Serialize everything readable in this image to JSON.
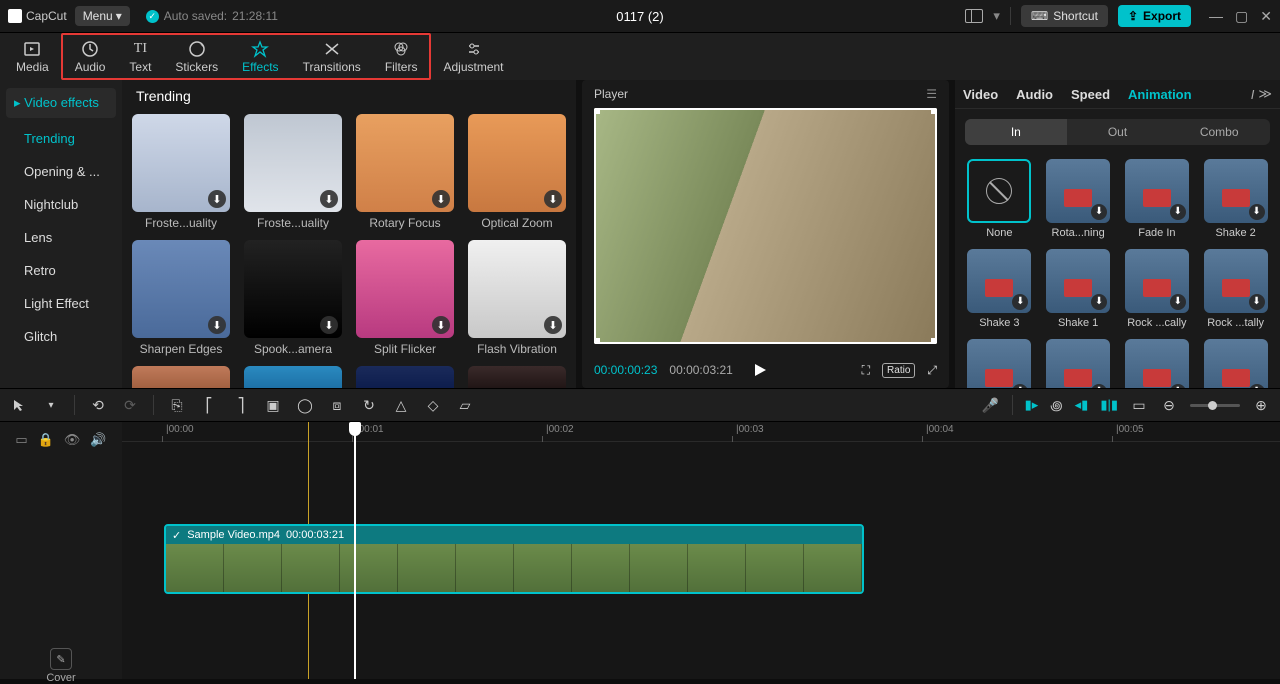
{
  "topbar": {
    "app_name": "CapCut",
    "menu_label": "Menu",
    "autosave_label": "Auto saved:",
    "autosave_time": "21:28:11",
    "doc_title": "0117 (2)",
    "shortcut_label": "Shortcut",
    "export_label": "Export"
  },
  "tooltabs": {
    "media": "Media",
    "audio": "Audio",
    "text": "Text",
    "stickers": "Stickers",
    "effects": "Effects",
    "transitions": "Transitions",
    "filters": "Filters",
    "adjustment": "Adjustment"
  },
  "effects_panel": {
    "header": "Video effects",
    "categories": [
      "Trending",
      "Opening & ...",
      "Nightclub",
      "Lens",
      "Retro",
      "Light Effect",
      "Glitch"
    ],
    "grid_title": "Trending",
    "items": [
      {
        "label": "Froste...uality",
        "bg": "linear-gradient(#cfd8e8,#a7b5cc)"
      },
      {
        "label": "Froste...uality",
        "bg": "linear-gradient(#bfc7d2,#e0e4ea)"
      },
      {
        "label": "Rotary Focus",
        "bg": "linear-gradient(#e8a060,#d08048)"
      },
      {
        "label": "Optical Zoom",
        "bg": "linear-gradient(#e89a58,#c87840)"
      },
      {
        "label": "Sharpen Edges",
        "bg": "linear-gradient(#6a89b8,#4a6a9a)"
      },
      {
        "label": "Spook...amera",
        "bg": "linear-gradient(#222,#000)"
      },
      {
        "label": "Split Flicker",
        "bg": "linear-gradient(#e86aa0,#b83a80)"
      },
      {
        "label": "Flash Vibration",
        "bg": "linear-gradient(#f0f0f0,#c8c8c8)"
      }
    ],
    "row3_bgs": [
      "linear-gradient(#c07a5a,#9a5a3a)",
      "linear-gradient(#2a8ac0,#1a6aa0)",
      "linear-gradient(#1a2a5a,#0a1a4a)",
      "linear-gradient(#3a2a2a,#1a1010)"
    ]
  },
  "player": {
    "title": "Player",
    "current_time": "00:00:00:23",
    "duration": "00:00:03:21",
    "ratio_label": "Ratio"
  },
  "right_panel": {
    "tabs": [
      "Video",
      "Audio",
      "Speed",
      "Animation"
    ],
    "subtabs": {
      "in": "In",
      "out": "Out",
      "combo": "Combo"
    },
    "items": [
      {
        "label": "None",
        "none": true
      },
      {
        "label": "Rota...ning"
      },
      {
        "label": "Fade In"
      },
      {
        "label": "Shake 2"
      },
      {
        "label": "Shake 3"
      },
      {
        "label": "Shake 1"
      },
      {
        "label": "Rock ...cally"
      },
      {
        "label": "Rock ...tally"
      },
      {
        "label": ""
      },
      {
        "label": ""
      },
      {
        "label": ""
      },
      {
        "label": ""
      }
    ]
  },
  "timeline": {
    "cover_label": "Cover",
    "marks": [
      "00:00",
      "00:01",
      "00:02",
      "00:03",
      "00:04",
      "00:05"
    ],
    "clip_name": "Sample Video.mp4",
    "clip_dur": "00:00:03:21"
  }
}
